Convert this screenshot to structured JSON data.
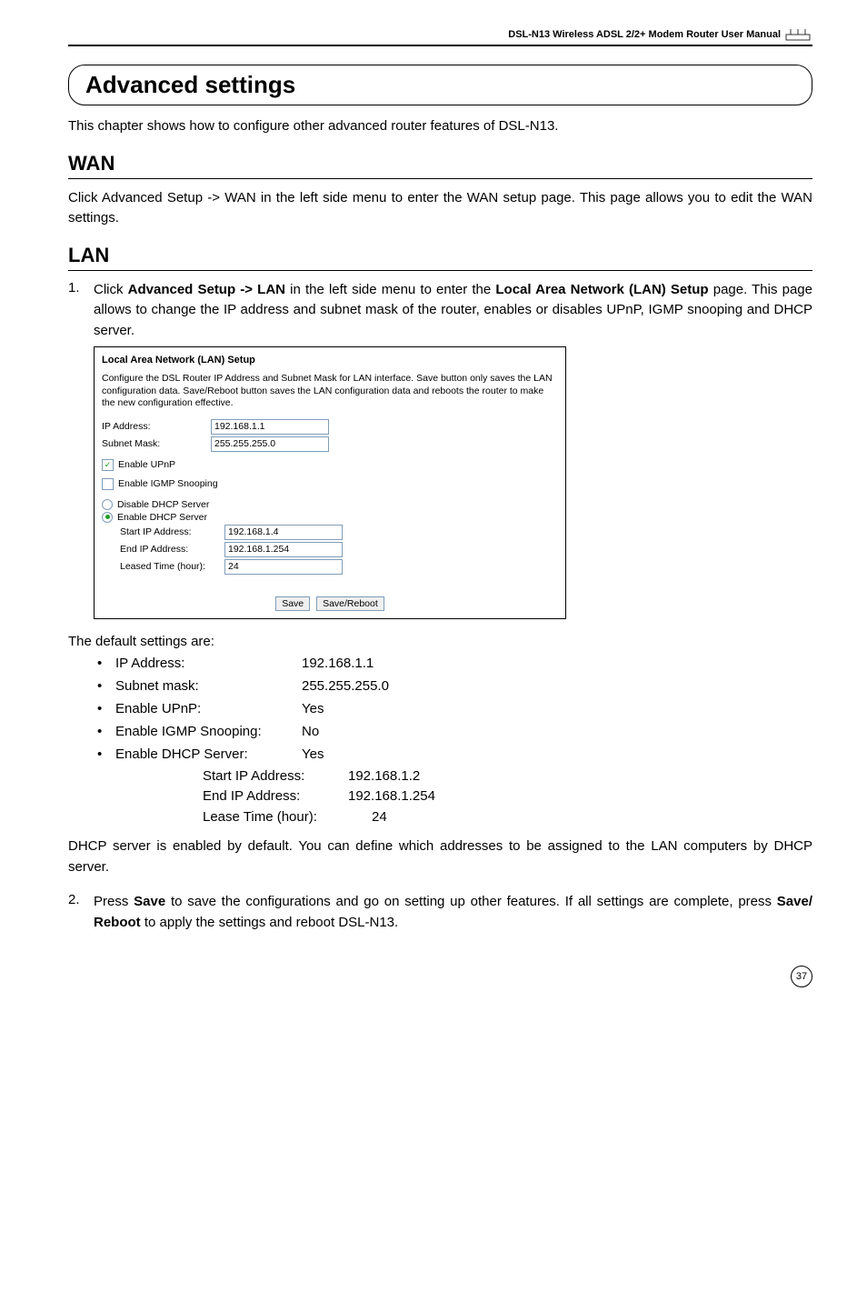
{
  "header": {
    "manual_title": "DSL-N13 Wireless ADSL 2/2+ Modem Router User Manual"
  },
  "section": {
    "title": "Advanced settings",
    "intro": "This chapter shows how to configure other advanced router features of DSL-N13."
  },
  "wan": {
    "heading": "WAN",
    "body": "Click Advanced Setup -> WAN in the left side menu to enter the WAN setup page. This page allows you to edit the WAN settings."
  },
  "lan": {
    "heading": "LAN",
    "step1_pre": "Click ",
    "step1_b1": "Advanced Setup -> LAN",
    "step1_mid": " in the left side menu to enter the ",
    "step1_b2": "Local Area Network (LAN) Setup",
    "step1_post": " page. This page allows to change the IP address and subnet mask of the router, enables or disables UPnP, IGMP snooping and DHCP server.",
    "step2_pre": "Press ",
    "step2_b1": "Save",
    "step2_mid": " to save the configurations and go on setting up other features. If all settings are complete, press ",
    "step2_b2": "Save/ Reboot",
    "step2_post": " to apply the settings and reboot DSL-N13."
  },
  "screenshot": {
    "title": "Local Area Network (LAN) Setup",
    "desc": "Configure the DSL Router IP Address and Subnet Mask for LAN interface.  Save button only saves the LAN configuration data. Save/Reboot button saves the LAN configuration data and reboots the router to make the new configuration effective.",
    "ip_label": "IP Address:",
    "ip_value": "192.168.1.1",
    "subnet_label": "Subnet Mask:",
    "subnet_value": "255.255.255.0",
    "enable_upnp": "Enable UPnP",
    "enable_igmp": "Enable IGMP Snooping",
    "disable_dhcp": "Disable DHCP Server",
    "enable_dhcp": "Enable DHCP Server",
    "start_ip_label": "Start IP Address:",
    "start_ip_value": "192.168.1.4",
    "end_ip_label": "End IP Address:",
    "end_ip_value": "192.168.1.254",
    "leased_label": "Leased Time (hour):",
    "leased_value": "24",
    "save_btn": "Save",
    "savereboot_btn": "Save/Reboot"
  },
  "defaults": {
    "title": "The default settings are:",
    "items": [
      {
        "label": "IP Address:",
        "value": "192.168.1.1"
      },
      {
        "label": "Subnet mask:",
        "value": "255.255.255.0"
      },
      {
        "label": "Enable UPnP:",
        "value": "Yes"
      },
      {
        "label": "Enable IGMP Snooping:",
        "value": "No"
      },
      {
        "label": "Enable DHCP Server:",
        "value": "Yes"
      }
    ],
    "sub": {
      "start_label": "Start IP Address:",
      "start_value": "192.168.1.2",
      "end_label": "End IP Address:",
      "end_value": "192.168.1.254",
      "lease_label": "Lease Time (hour):",
      "lease_value": "24"
    }
  },
  "dhcp_note": "DHCP server is enabled by default. You can define which addresses to be assigned to the LAN computers by DHCP server.",
  "page_number": "37"
}
